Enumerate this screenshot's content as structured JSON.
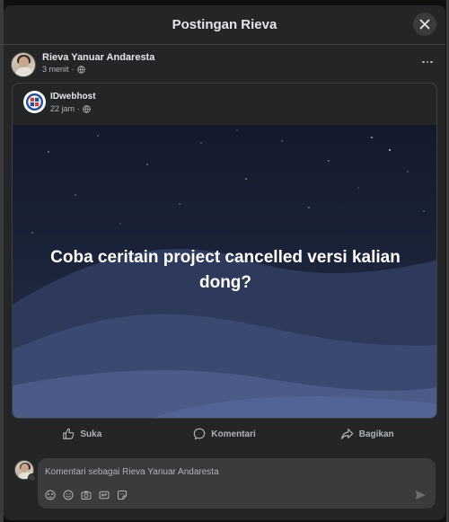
{
  "modal": {
    "title": "Postingan Rieva"
  },
  "post": {
    "author": "Rieva Yanuar Andaresta",
    "time": "3 menit",
    "separator": "·",
    "audience_icon": "globe-icon"
  },
  "shared": {
    "page_name": "IDwebhost",
    "time": "22 jam",
    "separator": "·",
    "headline": "Coba ceritain project cancelled versi kalian dong?"
  },
  "actions": {
    "like": "Suka",
    "comment": "Komentari",
    "share": "Bagikan"
  },
  "comment": {
    "placeholder": "Komentari sebagai Rieva Yanuar Andaresta"
  },
  "colors": {
    "surface": "#242526",
    "secondary_text": "#b0b3b8",
    "input_bg": "#3a3b3c"
  }
}
